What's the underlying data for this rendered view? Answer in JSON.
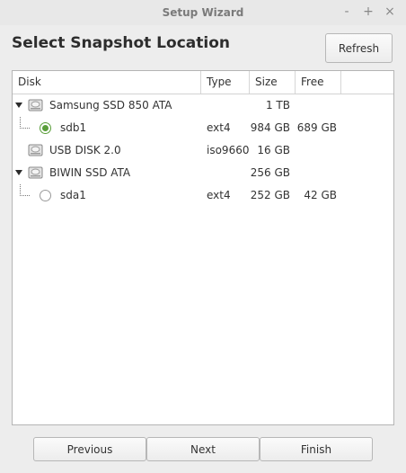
{
  "window": {
    "title": "Setup Wizard",
    "controls": {
      "minimize": "-",
      "maximize": "+",
      "close": "×"
    }
  },
  "heading": "Select Snapshot Location",
  "refresh_label": "Refresh",
  "columns": {
    "disk": "Disk",
    "type": "Type",
    "size": "Size",
    "free": "Free"
  },
  "rows": [
    {
      "kind": "disk",
      "name": "Samsung SSD 850 ATA",
      "type": "",
      "size": "1 TB",
      "free": "",
      "expanded": true
    },
    {
      "kind": "partition",
      "name": "sdb1",
      "type": "ext4",
      "size": "984 GB",
      "free": "689 GB",
      "selected": true
    },
    {
      "kind": "disk",
      "name": "USB DISK 2.0",
      "type": "iso9660",
      "size": "16 GB",
      "free": "",
      "expanded": false
    },
    {
      "kind": "disk",
      "name": "BIWIN SSD ATA",
      "type": "",
      "size": "256 GB",
      "free": "",
      "expanded": true
    },
    {
      "kind": "partition",
      "name": "sda1",
      "type": "ext4",
      "size": "252 GB",
      "free": "42 GB",
      "selected": false
    }
  ],
  "buttons": {
    "previous": "Previous",
    "next": "Next",
    "finish": "Finish"
  },
  "icons": {
    "disk": "hard-disk-icon",
    "expander": "expander-triangle-icon",
    "radio": "radio-icon"
  },
  "colors": {
    "selected_radio": "#5a9e3a",
    "background": "#ededed"
  }
}
